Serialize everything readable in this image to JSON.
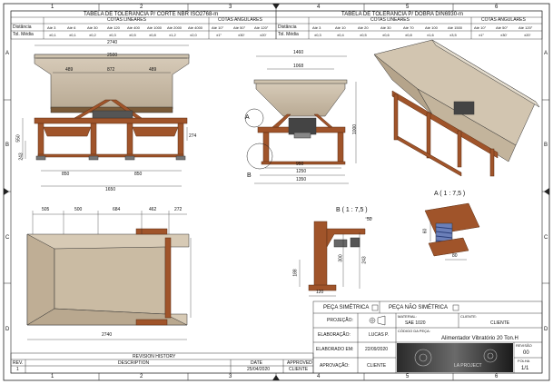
{
  "zone_numbers": {
    "top": [
      "1",
      "2",
      "3",
      "4",
      "5",
      "6"
    ],
    "bottom": [
      "1",
      "2",
      "3",
      "4",
      "5",
      "6"
    ]
  },
  "zone_letters": [
    "A",
    "B",
    "C",
    "D"
  ],
  "tol_left": {
    "title": "TABELA DE TOLERANCIA P/ CORTE NBR ISO2768-m",
    "linear_header": "COTAS LINEARES",
    "angular_header": "COTAS ANGULARES",
    "row1_label": "Distância",
    "row2_label": "Tol. Média",
    "linear_cols": [
      "Até 3",
      "Até 6",
      "Até 30",
      "Até 120",
      "Até 400",
      "Até 1000",
      "Até 2000",
      "Até 4000"
    ],
    "linear_vals": [
      "±0,1",
      "±0,1",
      "±0,2",
      "±0,3",
      "±0,5",
      "±0,8",
      "±1,2",
      "±2,0"
    ],
    "angular_cols": [
      "Até 10°",
      "Até 50°",
      "Até 120°"
    ],
    "angular_vals": [
      "±1°",
      "±30'",
      "±20'"
    ]
  },
  "tol_right": {
    "title": "TABELA DE TOLERANCIA P/ DOBRA DIN6930-m",
    "linear_header": "COTAS LINEARES",
    "angular_header": "COTAS ANGULARES",
    "row1_label": "Distância",
    "row2_label": "Tol. Média",
    "linear_cols": [
      "Até 3",
      "Até 10",
      "Até 20",
      "Até 30",
      "Até 70",
      "Até 100",
      "Até 1500"
    ],
    "linear_vals": [
      "±0,3",
      "±0,4",
      "±0,5",
      "±0,6",
      "±0,8",
      "±1,6",
      "±3,5"
    ],
    "angular_cols": [
      "Até 10°",
      "Até 50°",
      "Até 120°"
    ],
    "angular_vals": [
      "±1°",
      "±30'",
      "±20'"
    ]
  },
  "front_view": {
    "dims": [
      "2740",
      "2500",
      "489",
      "872",
      "489",
      "550",
      "243",
      "274",
      "850",
      "850",
      "1650"
    ]
  },
  "side_view": {
    "dims": [
      "1460",
      "1068",
      "1000",
      "950",
      "1250",
      "1350"
    ],
    "labels": [
      "A",
      "B"
    ]
  },
  "top_view": {
    "dims": [
      "505",
      "500",
      "684",
      "462",
      "272",
      "2740"
    ]
  },
  "detail_b": {
    "title": "B ( 1 : 7,5 )",
    "dims": [
      "50",
      "300",
      "188",
      "243",
      "120"
    ]
  },
  "detail_a": {
    "title": "A ( 1 : 7,5 )",
    "dims": [
      "60",
      "80"
    ]
  },
  "title_block": {
    "peca_simetrica": "PEÇA SIMÉTRICA",
    "peca_nao_simetrica": "PEÇA NÃO SIMÉTRICA",
    "projecao_label": "PROJEÇÃO:",
    "material_label": "MATERIAL:",
    "material_value": "SAE 1020",
    "cliente_label": "CLIENTE:",
    "cliente_value": "CLIENTE",
    "codigo_label": "CÓDIGO DA PEÇA:",
    "part_name": "Alimentador Vibratório 20 Ton.H",
    "elaboracao_label": "ELABORAÇÃO:",
    "elaboracao_value": "LUCAS P.",
    "elaborado_em_label": "ELABORADO EM:",
    "elaborado_em_value": "22/09/2020",
    "aprovacao_label": "APROVAÇÃO:",
    "aprovacao_value": "CLIENTE",
    "revisao_label": "REVISÃO",
    "revisao_value": "00",
    "folha_label": "FOLHA",
    "folha_value": "1/1",
    "logo_text": "LA PROJECT"
  },
  "revision": {
    "title": "REVISION HISTORY",
    "headers": [
      "REV.",
      "DESCRIPTION",
      "DATE",
      "APPROVED"
    ],
    "row": [
      "1",
      "",
      "25/04/2020",
      "CLIENTE"
    ]
  }
}
